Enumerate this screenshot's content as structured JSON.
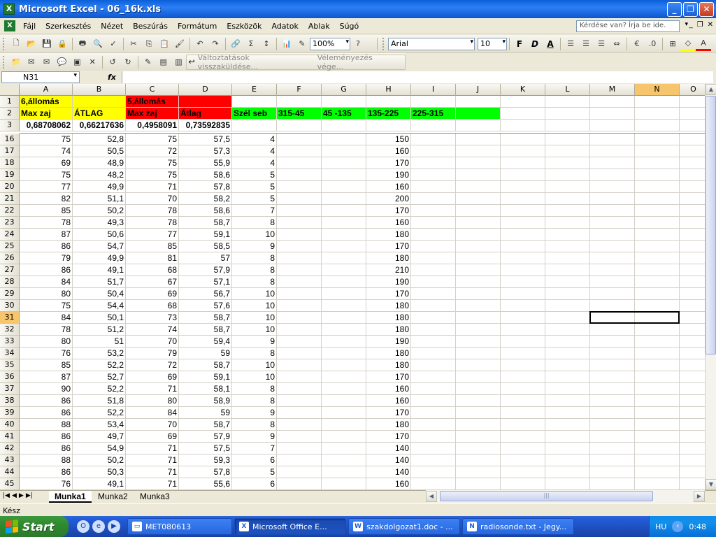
{
  "window": {
    "title": "Microsoft Excel - 06_16k.xls",
    "minimize": "_",
    "restore": "❐",
    "close": "✕"
  },
  "menu": {
    "items": [
      "Fájl",
      "Szerkesztés",
      "Nézet",
      "Beszúrás",
      "Formátum",
      "Eszközök",
      "Adatok",
      "Ablak",
      "Súgó"
    ],
    "help_placeholder": "Kérdése van? Írja be ide."
  },
  "toolbar": {
    "zoom": "100%",
    "font_name": "Arial",
    "font_size": "10",
    "bold": "F",
    "italic": "D",
    "underline": "A",
    "review_send": "Változtatások visszaküldése...",
    "review_end": "Véleményezés vége..."
  },
  "formula_bar": {
    "name_box": "N31",
    "fx": "fx",
    "content": ""
  },
  "grid": {
    "columns": [
      "A",
      "B",
      "C",
      "D",
      "E",
      "F",
      "G",
      "H",
      "I",
      "J",
      "K",
      "L",
      "M",
      "N",
      "O"
    ],
    "selected_column": "N",
    "selected_row": "31",
    "header_rows": [
      {
        "row": "1",
        "cells": [
          {
            "col": "A",
            "text": "6,állomás",
            "bold": true,
            "bg": "yellow"
          },
          {
            "col": "B",
            "text": "",
            "bg": "yellow"
          },
          {
            "col": "C",
            "text": "5,állomás",
            "bold": true,
            "bg": "red"
          },
          {
            "col": "D",
            "text": "",
            "bg": "red"
          }
        ]
      },
      {
        "row": "2",
        "cells": [
          {
            "col": "A",
            "text": "Max zaj",
            "bold": true,
            "bg": "yellow"
          },
          {
            "col": "B",
            "text": "ÁTLAG",
            "bold": true,
            "bg": "yellow"
          },
          {
            "col": "C",
            "text": "Max zaj",
            "bold": true,
            "bg": "red"
          },
          {
            "col": "D",
            "text": "Átlag",
            "bold": true,
            "bg": "red"
          },
          {
            "col": "E",
            "text": "Szél seb",
            "bold": true,
            "bg": "green"
          },
          {
            "col": "F",
            "text": "315-45",
            "bold": true,
            "bg": "green"
          },
          {
            "col": "G",
            "text": "45 -135",
            "bold": true,
            "bg": "green"
          },
          {
            "col": "H",
            "text": "135-225",
            "bold": true,
            "bg": "green"
          },
          {
            "col": "I",
            "text": "225-315",
            "bold": true,
            "bg": "green"
          },
          {
            "col": "J",
            "text": "",
            "bg": "green"
          }
        ]
      },
      {
        "row": "3",
        "cells": [
          {
            "col": "A",
            "text": "0,68708062",
            "bold": true,
            "num": true
          },
          {
            "col": "B",
            "text": "0,66217636",
            "bold": true,
            "num": true
          },
          {
            "col": "C",
            "text": "0,4958091",
            "bold": true,
            "num": true
          },
          {
            "col": "D",
            "text": "0,73592835",
            "bold": true,
            "num": true
          }
        ]
      }
    ],
    "data_rows": [
      {
        "row": "16",
        "A": "75",
        "B": "52,8",
        "C": "75",
        "D": "57,5",
        "E": "4",
        "H": "150"
      },
      {
        "row": "17",
        "A": "74",
        "B": "50,5",
        "C": "72",
        "D": "57,3",
        "E": "4",
        "H": "160"
      },
      {
        "row": "18",
        "A": "69",
        "B": "48,9",
        "C": "75",
        "D": "55,9",
        "E": "4",
        "H": "170"
      },
      {
        "row": "19",
        "A": "75",
        "B": "48,2",
        "C": "75",
        "D": "58,6",
        "E": "5",
        "H": "190"
      },
      {
        "row": "20",
        "A": "77",
        "B": "49,9",
        "C": "71",
        "D": "57,8",
        "E": "5",
        "H": "160"
      },
      {
        "row": "21",
        "A": "82",
        "B": "51,1",
        "C": "70",
        "D": "58,2",
        "E": "5",
        "H": "200"
      },
      {
        "row": "22",
        "A": "85",
        "B": "50,2",
        "C": "78",
        "D": "58,6",
        "E": "7",
        "H": "170"
      },
      {
        "row": "23",
        "A": "78",
        "B": "49,3",
        "C": "78",
        "D": "58,7",
        "E": "8",
        "H": "160"
      },
      {
        "row": "24",
        "A": "87",
        "B": "50,6",
        "C": "77",
        "D": "59,1",
        "E": "10",
        "H": "180"
      },
      {
        "row": "25",
        "A": "86",
        "B": "54,7",
        "C": "85",
        "D": "58,5",
        "E": "9",
        "H": "170"
      },
      {
        "row": "26",
        "A": "79",
        "B": "49,9",
        "C": "81",
        "D": "57",
        "E": "8",
        "H": "180"
      },
      {
        "row": "27",
        "A": "86",
        "B": "49,1",
        "C": "68",
        "D": "57,9",
        "E": "8",
        "H": "210"
      },
      {
        "row": "28",
        "A": "84",
        "B": "51,7",
        "C": "67",
        "D": "57,1",
        "E": "8",
        "H": "190"
      },
      {
        "row": "29",
        "A": "80",
        "B": "50,4",
        "C": "69",
        "D": "56,7",
        "E": "10",
        "H": "170"
      },
      {
        "row": "30",
        "A": "75",
        "B": "54,4",
        "C": "68",
        "D": "57,6",
        "E": "10",
        "H": "180"
      },
      {
        "row": "31",
        "A": "84",
        "B": "50,1",
        "C": "73",
        "D": "58,7",
        "E": "10",
        "H": "180"
      },
      {
        "row": "32",
        "A": "78",
        "B": "51,2",
        "C": "74",
        "D": "58,7",
        "E": "10",
        "H": "180"
      },
      {
        "row": "33",
        "A": "80",
        "B": "51",
        "C": "70",
        "D": "59,4",
        "E": "9",
        "H": "190"
      },
      {
        "row": "34",
        "A": "76",
        "B": "53,2",
        "C": "79",
        "D": "59",
        "E": "8",
        "H": "180"
      },
      {
        "row": "35",
        "A": "85",
        "B": "52,2",
        "C": "72",
        "D": "58,7",
        "E": "10",
        "H": "180"
      },
      {
        "row": "36",
        "A": "87",
        "B": "52,7",
        "C": "69",
        "D": "59,1",
        "E": "10",
        "H": "170"
      },
      {
        "row": "37",
        "A": "90",
        "B": "52,2",
        "C": "71",
        "D": "58,1",
        "E": "8",
        "H": "160"
      },
      {
        "row": "38",
        "A": "86",
        "B": "51,8",
        "C": "80",
        "D": "58,9",
        "E": "8",
        "H": "160"
      },
      {
        "row": "39",
        "A": "86",
        "B": "52,2",
        "C": "84",
        "D": "59",
        "E": "9",
        "H": "170"
      },
      {
        "row": "40",
        "A": "88",
        "B": "53,4",
        "C": "70",
        "D": "58,7",
        "E": "8",
        "H": "180"
      },
      {
        "row": "41",
        "A": "86",
        "B": "49,7",
        "C": "69",
        "D": "57,9",
        "E": "9",
        "H": "170"
      },
      {
        "row": "42",
        "A": "86",
        "B": "54,9",
        "C": "71",
        "D": "57,5",
        "E": "7",
        "H": "140"
      },
      {
        "row": "43",
        "A": "88",
        "B": "50,2",
        "C": "71",
        "D": "59,3",
        "E": "6",
        "H": "140"
      },
      {
        "row": "44",
        "A": "86",
        "B": "50,3",
        "C": "71",
        "D": "57,8",
        "E": "5",
        "H": "140"
      },
      {
        "row": "45",
        "A": "76",
        "B": "49,1",
        "C": "71",
        "D": "55,6",
        "E": "6",
        "H": "160"
      }
    ]
  },
  "sheets": [
    "Munka1",
    "Munka2",
    "Munka3"
  ],
  "active_sheet": "Munka1",
  "status": "Kész",
  "taskbar": {
    "start": "Start",
    "tasks": [
      {
        "label": "MET080613",
        "icon": "folder-icon"
      },
      {
        "label": "Microsoft Office E...",
        "icon": "excel-icon",
        "active": true
      },
      {
        "label": "szakdolgozat1.doc - ...",
        "icon": "word-icon"
      },
      {
        "label": "radiosonde.txt - Jegy...",
        "icon": "notepad-icon"
      }
    ],
    "lang": "HU",
    "clock": "0:48"
  },
  "colors": {
    "yellow": "#ffff00",
    "red": "#ff0000",
    "green": "#00ff00",
    "selection_header": "#f7c56c"
  }
}
